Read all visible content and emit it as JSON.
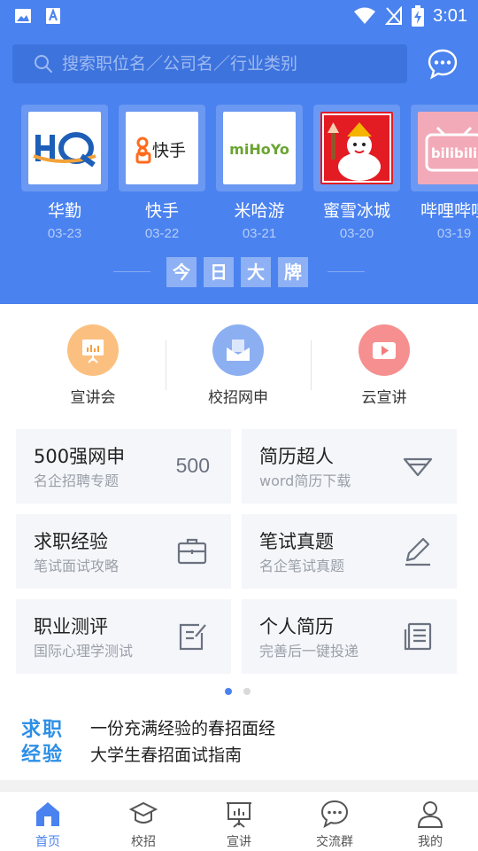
{
  "status_bar": {
    "time": "3:01"
  },
  "search": {
    "placeholder": "搜索职位名／公司名／行业类别"
  },
  "brands": [
    {
      "name": "华勤",
      "date": "03-23"
    },
    {
      "name": "快手",
      "date": "03-22",
      "logo_text": "快手"
    },
    {
      "name": "米哈游",
      "date": "03-21",
      "logo_text": "miHoYo"
    },
    {
      "name": "蜜雪冰城",
      "date": "03-20"
    },
    {
      "name": "哔哩哔哩",
      "date": "03-19",
      "logo_text": "bilibili"
    }
  ],
  "today_banner": [
    "今",
    "日",
    "大",
    "牌"
  ],
  "quick_entries": [
    {
      "label": "宣讲会",
      "icon": "presentation-icon",
      "color": "#f7b86a"
    },
    {
      "label": "校招网申",
      "icon": "envelope-icon",
      "color": "#7aa3f0"
    },
    {
      "label": "云宣讲",
      "icon": "video-icon",
      "color": "#f47c7c"
    }
  ],
  "cards": [
    {
      "title": "500强网申",
      "sub": "名企招聘专题",
      "badge": "500"
    },
    {
      "title": "简历超人",
      "sub": "word简历下载",
      "icon": "diamond-icon"
    },
    {
      "title": "求职经验",
      "sub": "笔试面试攻略",
      "icon": "briefcase-icon"
    },
    {
      "title": "笔试真题",
      "sub": "名企笔试真题",
      "icon": "pencil-icon"
    },
    {
      "title": "职业测评",
      "sub": "国际心理学测试",
      "icon": "edit-form-icon"
    },
    {
      "title": "个人简历",
      "sub": "完善后一键投递",
      "icon": "resume-icon"
    }
  ],
  "pager": {
    "count": 2,
    "active": 0
  },
  "article": {
    "logo_line1": "求职",
    "logo_line2": "经验",
    "lines": [
      "一份充满经验的春招面经",
      "大学生春招面试指南"
    ]
  },
  "bottom_nav": [
    {
      "label": "首页",
      "icon": "home-icon",
      "active": true
    },
    {
      "label": "校招",
      "icon": "graduation-cap-icon"
    },
    {
      "label": "宣讲",
      "icon": "presentation-icon"
    },
    {
      "label": "交流群",
      "icon": "chat-bubble-icon"
    },
    {
      "label": "我的",
      "icon": "user-icon"
    }
  ],
  "colors": {
    "primary": "#4a82ef",
    "card_bg": "#f5f6fa",
    "article_accent": "#2d8fe6"
  }
}
